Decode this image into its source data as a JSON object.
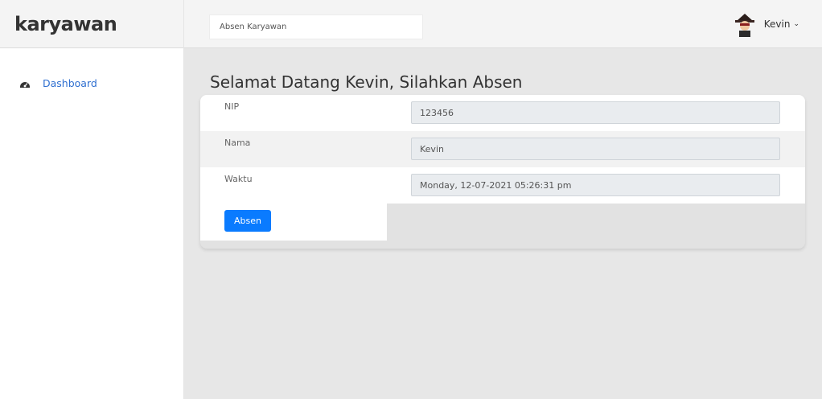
{
  "brand": {
    "title": "karyawan"
  },
  "sidebar": {
    "items": [
      {
        "label": "Dashboard",
        "icon": "dashboard-icon"
      }
    ]
  },
  "topbar": {
    "search_value": "Absen Karyawan",
    "user_name": "Kevin",
    "user_chevron": "⌄"
  },
  "main": {
    "title": "Selamat Datang Kevin, Silahkan Absen",
    "form": {
      "rows": [
        {
          "label": "NIP",
          "value": "123456"
        },
        {
          "label": "Nama",
          "value": "Kevin"
        },
        {
          "label": "Waktu",
          "value": "Monday, 12-07-2021 05:26:31 pm"
        }
      ],
      "submit_label": "Absen"
    }
  },
  "colors": {
    "accent": "#0a7bff",
    "link": "#2f6fd0",
    "content_bg": "#e7e7e7"
  }
}
